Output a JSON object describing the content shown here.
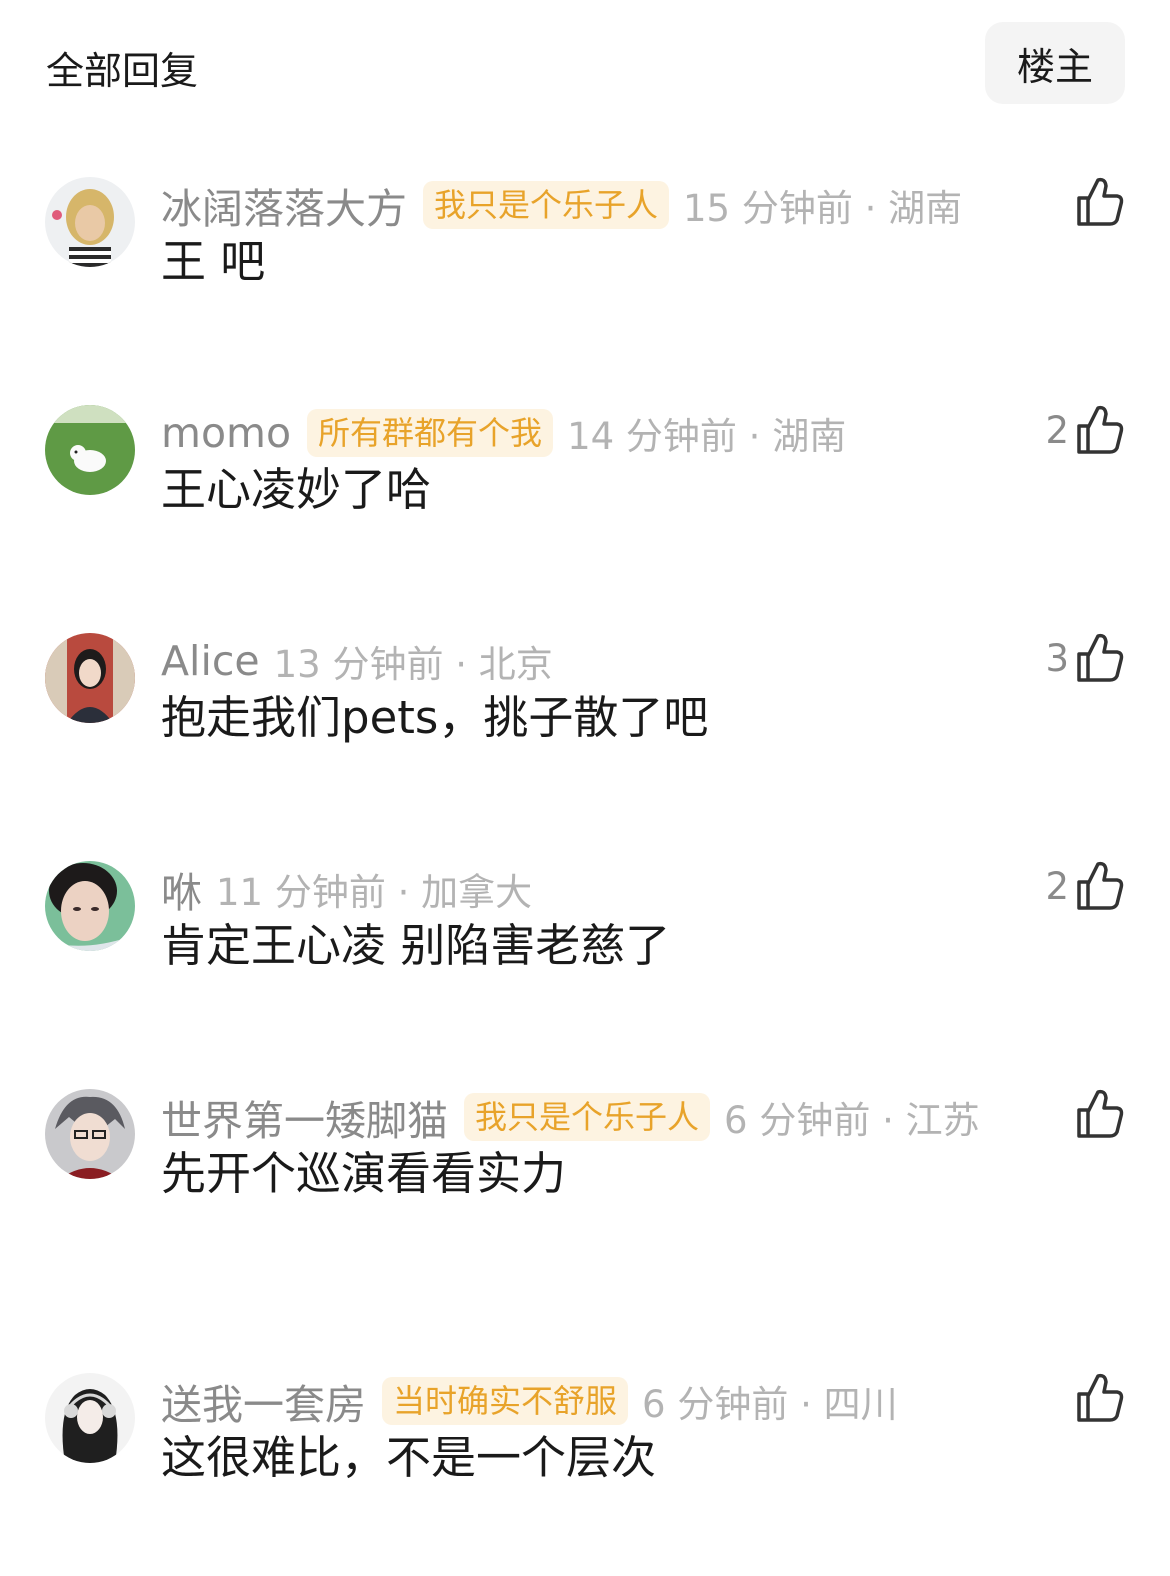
{
  "header": {
    "title": "全部回复",
    "filter_label": "楼主"
  },
  "comments": [
    {
      "username": "冰阔落落大方",
      "badge": "我只是个乐子人",
      "time_location": "15 分钟前 · 湖南",
      "text": "王 吧",
      "likes": "",
      "avatar": "blonde-character-avatar"
    },
    {
      "username": "momo",
      "badge": "所有群都有个我",
      "time_location": "14 分钟前 · 湖南",
      "text": "王心凌妙了哈",
      "likes": "2",
      "avatar": "dog-on-grass-avatar"
    },
    {
      "username": "Alice",
      "badge": "",
      "time_location": "13 分钟前 · 北京",
      "text": "抱走我们pets，挑子散了吧",
      "likes": "3",
      "avatar": "girl-portrait-avatar"
    },
    {
      "username": "咻",
      "badge": "",
      "time_location": "11 分钟前 · 加拿大",
      "text": "肯定王心凌 别陷害老慈了",
      "likes": "2",
      "avatar": "face-closeup-avatar"
    },
    {
      "username": "世界第一矮脚猫",
      "badge": "我只是个乐子人",
      "time_location": "6 分钟前 · 江苏",
      "text": "先开个巡演看看实力",
      "likes": "",
      "avatar": "anime-glasses-avatar"
    },
    {
      "username": "送我一套房",
      "badge": "当时确实不舒服",
      "time_location": "6 分钟前 · 四川",
      "text": "这很难比，不是一个层次",
      "likes": "",
      "avatar": "headphone-girl-avatar"
    }
  ],
  "colors": {
    "badge_bg": "#fdf3e1",
    "badge_text": "#e8a32a",
    "meta_text": "#b3b3b3",
    "username_text": "#8a8a8a"
  }
}
